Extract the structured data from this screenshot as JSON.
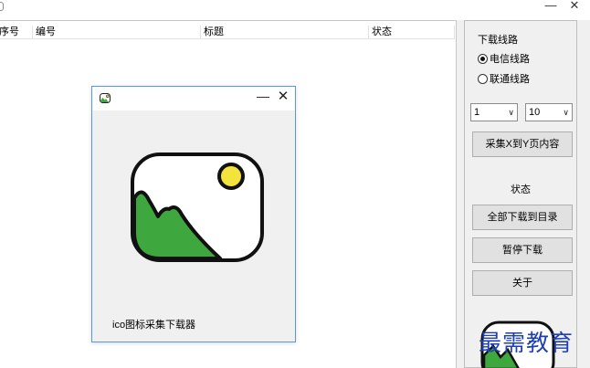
{
  "window": {
    "minimize_glyph": "—",
    "close_glyph": "✕"
  },
  "listview": {
    "columns": [
      "序号",
      "编号",
      "标题",
      "状态"
    ]
  },
  "panel": {
    "route_group_title": "下载线路",
    "routes": [
      {
        "label": "电信线路",
        "checked": true
      },
      {
        "label": "联通线路",
        "checked": false
      }
    ],
    "from_page": "1",
    "to_page": "10",
    "collect_button": "采集X到Y页内容",
    "status_label": "状态",
    "download_all_button": "全部下载到目录",
    "pause_button": "暂停下载",
    "about_button": "关于"
  },
  "popup": {
    "caption": "ico图标采集下载器",
    "minimize_glyph": "—",
    "close_glyph": "✕"
  },
  "icons": {
    "app_icon": "image-icon",
    "combo_arrow": "chevron-down-icon",
    "large_art": "image-icon",
    "art_colors": {
      "mountain": "#3ea83f",
      "sun": "#f2e43c",
      "outline": "#111111"
    }
  },
  "watermark": "最需教育"
}
